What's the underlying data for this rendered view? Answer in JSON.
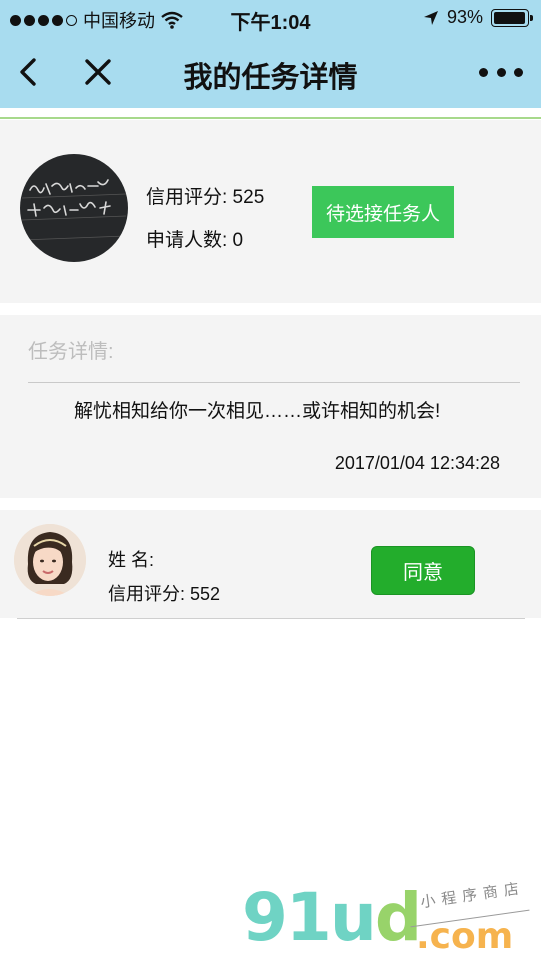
{
  "status_bar": {
    "carrier": "中国移动",
    "time": "下午1:04",
    "battery": "93%",
    "battery_level": 0.93
  },
  "nav": {
    "title": "我的任务详情"
  },
  "publisher": {
    "credit_label": "信用评分: 525",
    "applicants_label": "申请人数: 0",
    "status_button": "待选接任务人"
  },
  "task": {
    "detail_label": "任务详情:",
    "description": "解忧相知给你一次相见……或许相知的机会!",
    "datetime": "2017/01/04 12:34:28"
  },
  "applicant": {
    "name_label": "姓 名:",
    "credit_label": "信用评分: 552",
    "agree_button": "同意"
  },
  "watermark": {
    "logo_main": "91u",
    "logo_d": "d",
    "logo_com": ".com",
    "tagline": "小程序商店"
  },
  "colors": {
    "nav_bg": "#a8dcef",
    "card_bg": "#f4f4f4",
    "pending_green": "#3cc75a",
    "agree_green": "#23ad2c",
    "divider_green": "#a7d98b"
  }
}
